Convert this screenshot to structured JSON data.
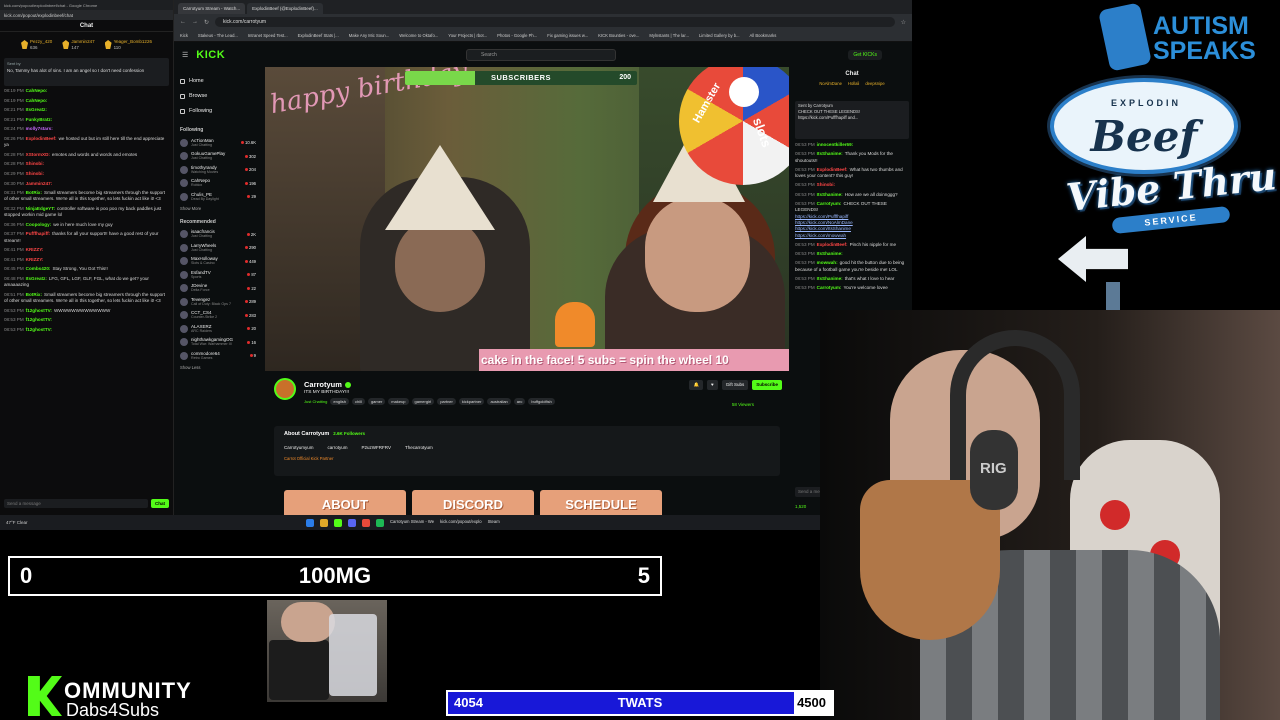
{
  "popout_chat": {
    "window_title": "kick.com/popout/explodinbeef/chat - Google Chrome",
    "url": "kick.com/popout/explodinbeef/chat",
    "header": "Chat",
    "gifters": [
      {
        "name": "Pezzy_420",
        "count": "636"
      },
      {
        "name": "Jammin247",
        "count": "147"
      },
      {
        "name": "Yeager_Bomb1226",
        "count": "110"
      }
    ],
    "pinned_label": "Sent by",
    "pinned_text": "No, Tammy has alot of sins. I am an angel so I don't need confession",
    "messages": [
      {
        "time": "08:19 PM",
        "user": "CahNepo:",
        "color": "#53fc18",
        "text": ""
      },
      {
        "time": "08:19 PM",
        "user": "CahNepo:",
        "color": "#53fc18",
        "text": ""
      },
      {
        "time": "08:21 PM",
        "user": "ItsGreatz:",
        "color": "#53fc18",
        "text": ""
      },
      {
        "time": "08:21 PM",
        "user": "FunkyBratz:",
        "color": "#53fc18",
        "text": ""
      },
      {
        "time": "08:24 PM",
        "user": "molly7stars:",
        "color": "#c86bff",
        "text": ""
      },
      {
        "time": "08:26 PM",
        "user": "ExplodinBeef:",
        "color": "#ff4646",
        "text": "we hosted out but im still here till the end appreciate ya"
      },
      {
        "time": "08:28 PM",
        "user": "XStormXD:",
        "color": "#ff4646",
        "text": "emotes and words and words and emotes"
      },
      {
        "time": "08:28 PM",
        "user": "Shinobi:",
        "color": "#ff4646",
        "text": ""
      },
      {
        "time": "08:29 PM",
        "user": "Shinobi:",
        "color": "#ff4646",
        "text": ""
      },
      {
        "time": "08:30 PM",
        "user": "Jammin247:",
        "color": "#ff4646",
        "text": ""
      },
      {
        "time": "08:31 PM",
        "user": "BotRix:",
        "color": "#53fc18",
        "text": "Small streamers become big streamers through the support of other small streamers. We're all in this together, so lets fuckin act like it! <3"
      },
      {
        "time": "08:32 PM",
        "user": "NinjaEdgeYT:",
        "color": "#53fc18",
        "text": "controller software is poo poo my back paddles just stopped workin mid game lol"
      },
      {
        "time": "08:36 PM",
        "user": "Coopology:",
        "color": "#53fc18",
        "text": "we in here much love my guy"
      },
      {
        "time": "08:37 PM",
        "user": "Pufffhapiff:",
        "color": "#ff4646",
        "text": "thanks for all your support!! have a good rest of your stream!!"
      },
      {
        "time": "08:41 PM",
        "user": "KRIZZY:",
        "color": "#ff4646",
        "text": ""
      },
      {
        "time": "08:41 PM",
        "user": "KRIZZY:",
        "color": "#ff4646",
        "text": ""
      },
      {
        "time": "08:45 PM",
        "user": "Combs420:",
        "color": "#53fc18",
        "text": "Stay Strong, You Got This!!"
      },
      {
        "time": "08:48 PM",
        "user": "ItsGreatz:",
        "color": "#53fc18",
        "text": "LFG, GFL, LGF, GLF, FGL, what do we get? your amaaaazing"
      },
      {
        "time": "08:51 PM",
        "user": "BotRix:",
        "color": "#53fc18",
        "text": "Small streamers become big streamers through the support of other small streamers. We're all in this together, so lets fuckin act like it! <3"
      },
      {
        "time": "08:53 PM",
        "user": "f12ghostTV:",
        "color": "#53fc18",
        "text": "WWWWWWWWWWWWW"
      },
      {
        "time": "08:53 PM",
        "user": "f12ghostTV:",
        "color": "#53fc18",
        "text": ""
      },
      {
        "time": "08:53 PM",
        "user": "f12ghostTV:",
        "color": "#53fc18",
        "text": ""
      }
    ],
    "input_placeholder": "Send a message",
    "send_label": "Chat"
  },
  "browser": {
    "tabs": [
      "Carrotyum Stream - Watch...",
      "ExplodinBeef (@ExplodinBeef)..."
    ],
    "url": "kick.com/carrotyum",
    "bookmarks": [
      "Kick",
      "Stakeus - The Lead...",
      "Intranet Speed Test...",
      "ExplodinBeef Stats |...",
      "Make Any Mic Soun...",
      "Welcome to Oktafo...",
      "Your Projects | rbot...",
      "Photos - Google Ph...",
      "Fix gaming issues w...",
      "KICK Bounties - ove...",
      "Mylnstants | The lar...",
      "Limited Gallery by b...",
      "All Bookmarks"
    ]
  },
  "kick": {
    "logo": "KICK",
    "search_placeholder": "Search",
    "get_kicks": "Get KICKs",
    "nav": [
      "Home",
      "Browse",
      "Following"
    ],
    "following_heading": "Following",
    "following": [
      {
        "name": "AcTionMan",
        "category": "Just Chatting",
        "viewers": "10.6K"
      },
      {
        "name": "GokuuGamePlay",
        "category": "Just Chatting",
        "viewers": "302"
      },
      {
        "name": "timothyrandy",
        "category": "Watching Movies",
        "viewers": "204"
      },
      {
        "name": "CahNepo",
        "category": "Roblox",
        "viewers": "196"
      },
      {
        "name": "Chulis_PE",
        "category": "Dead By Daylight",
        "viewers": "29"
      }
    ],
    "show_more": "Show More",
    "recommended_heading": "Recommended",
    "recommended": [
      {
        "name": "isaacfrancis",
        "category": "Just Chatting",
        "viewers": "2K"
      },
      {
        "name": "LarryWheels",
        "category": "Just Chatting",
        "viewers": "290"
      },
      {
        "name": "MaxHolloway",
        "category": "Slots & Casino",
        "viewers": "449"
      },
      {
        "name": "EsfandTV",
        "category": "Sports",
        "viewers": "87"
      },
      {
        "name": "JDevine",
        "category": "Delta Force",
        "viewers": "22"
      },
      {
        "name": "Tevengez",
        "category": "Call of Duty: Black Ops 7",
        "viewers": "289"
      },
      {
        "name": "CCT_CS4",
        "category": "Counter-Strike 2",
        "viewers": "283"
      },
      {
        "name": "ALAXERZ",
        "category": "ARC Raiders",
        "viewers": "20"
      },
      {
        "name": "nighthawkgamingOG",
        "category": "Total War: Warhammer III",
        "viewers": "16"
      },
      {
        "name": "commodore64",
        "category": "Retro Games",
        "viewers": "9"
      }
    ],
    "show_less": "Show Less"
  },
  "stream": {
    "subs_label": "SUBSCRIBERS",
    "subs_goal": "200",
    "subs_progress": 0.3,
    "birthday_text": "happy birthday",
    "wheel_texts": [
      "Hamster",
      "slots"
    ],
    "ticker": "cake in the face!   5 subs = spin the wheel   10"
  },
  "channel": {
    "name": "Carrotyum",
    "title": "ITS MY BIRTHDAY!!!",
    "category": "Just Chatting",
    "tags": [
      "english",
      "chill",
      "gamer",
      "makeup",
      "gamergirl",
      "partner",
      "kickpartner",
      "australian",
      "arc",
      "buffgoldfish"
    ],
    "gift_subs": "Gift Subs",
    "subscribe": "Subscribe",
    "viewers": "58 Viewers",
    "about_heading": "About Carrotyum",
    "followers": "2.6K Followers",
    "socials": [
      "Carrotyumyum",
      "carrotyum",
      "P2uzWFRFRV",
      "Thecarrotyum"
    ],
    "bio": "Carrot   Official Kick Partner",
    "panels": [
      "ABOUT",
      "DISCORD",
      "SCHEDULE"
    ]
  },
  "side_chat": {
    "header": "Chat",
    "gifters": [
      "NoAlmDane",
      "Hollali",
      "deepsnipe"
    ],
    "pinned": [
      "Sent by Carrotyum",
      "CHECK OUT THESE LEGENDS!",
      "https://kick.com/Pufffhapiff and..."
    ],
    "messages": [
      {
        "time": "08:53 PM",
        "user": "innocentkiller69:",
        "color": "#53fc18",
        "text": "",
        "links": []
      },
      {
        "time": "08:53 PM",
        "user": "ItsShanime:",
        "color": "#53fc18",
        "text": "Thank you Mods for the shoutouts!!",
        "links": []
      },
      {
        "time": "08:53 PM",
        "user": "ExplodinBeef:",
        "color": "#ff4646",
        "text": "What has two thumbs and loves your content? this guy!",
        "links": []
      },
      {
        "time": "08:53 PM",
        "user": "Shinobi:",
        "color": "#ff4646",
        "text": "",
        "links": []
      },
      {
        "time": "08:53 PM",
        "user": "ItsShanime:",
        "color": "#53fc18",
        "text": "How are we all doinnggg?",
        "links": []
      },
      {
        "time": "08:53 PM",
        "user": "Carrotyum:",
        "color": "#53fc18",
        "text": "CHECK OUT THESE LEGENDS!",
        "links": [
          "https://kick.com/Pufffhapiff",
          "https://kick.com/NoAlmDane",
          "https://kick.com/ItsShanime",
          "https://kick.com/mowwah"
        ]
      },
      {
        "time": "08:53 PM",
        "user": "ExplodinBeef:",
        "color": "#ff4646",
        "text": "Pinch his nipple for me",
        "links": []
      },
      {
        "time": "08:53 PM",
        "user": "ItsShanime:",
        "color": "#53fc18",
        "text": "",
        "links": []
      },
      {
        "time": "08:53 PM",
        "user": "mowwah:",
        "color": "#53fc18",
        "text": "good hit the button due to being because of a football game you're beside me! LOL",
        "links": []
      },
      {
        "time": "08:53 PM",
        "user": "ItsShanime:",
        "color": "#53fc18",
        "text": "that's what I love to hear",
        "links": []
      },
      {
        "time": "08:53 PM",
        "user": "Carrotyum:",
        "color": "#53fc18",
        "text": "You're welcome lovee",
        "links": []
      }
    ],
    "input_placeholder": "Send a message",
    "points": "1,520"
  },
  "taskbar": {
    "weather": "47°F Clear",
    "windows": [
      "Carrotyum Stream - We",
      "kick.com/popout/explo",
      "Steam"
    ]
  },
  "overlays": {
    "autism_speaks": [
      "AUTISM",
      "SPEAKS"
    ],
    "logo_top": "EXPLODIN",
    "logo_beef": "Beef",
    "logo_vibe": "Vibe Thru",
    "logo_service": "SERVICE",
    "headset_brand": "RIG",
    "goal_bar": {
      "left": "0",
      "center": "100MG",
      "right": "5"
    },
    "kommunity_title": "OMMUNITY",
    "kommunity_sub": "Dabs4Subs",
    "twats_bar": {
      "current": "4054",
      "label": "TWATS",
      "goal": "4500",
      "progress": 0.9
    }
  }
}
